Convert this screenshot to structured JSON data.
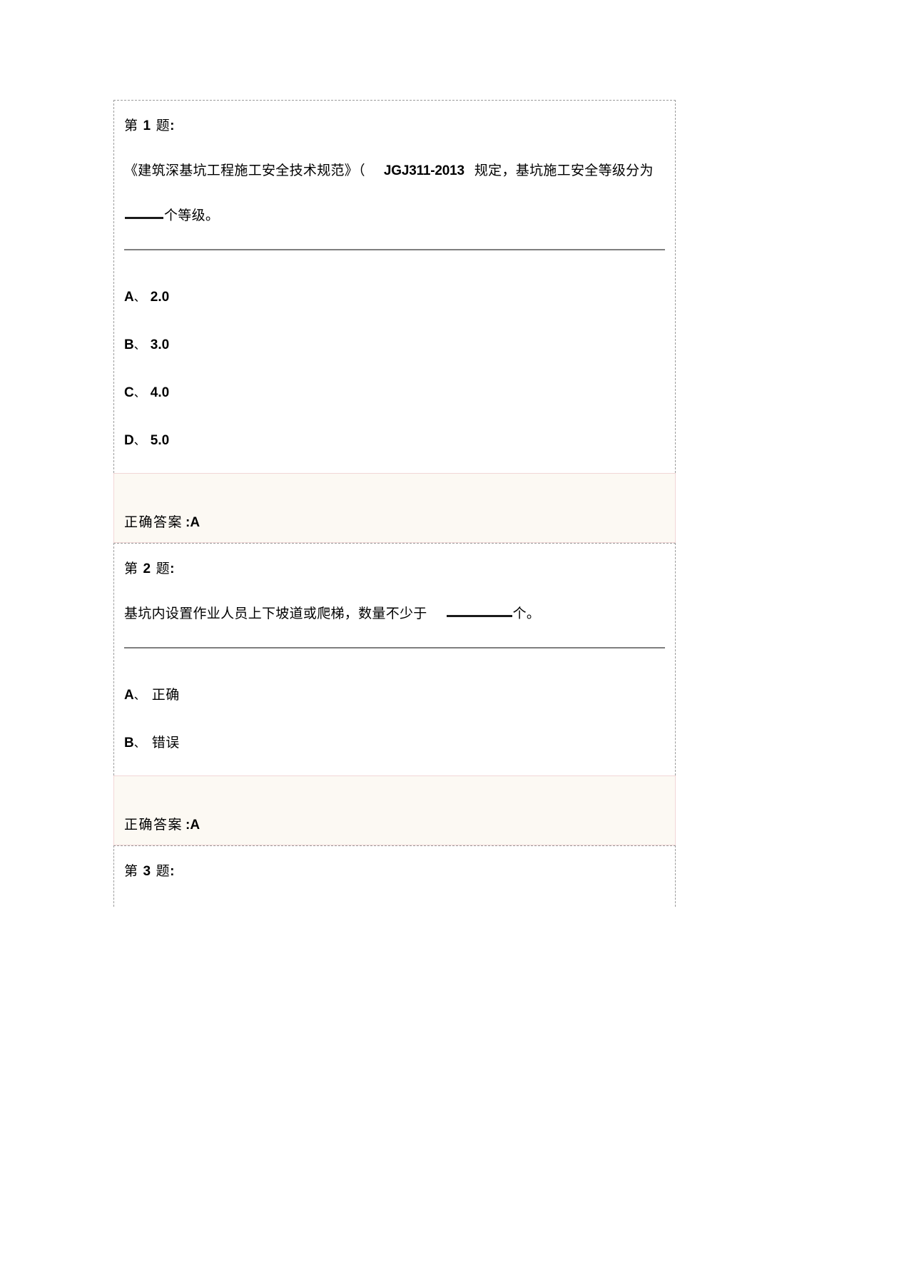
{
  "document": {
    "type": "exam-question-sheet",
    "background_color": "#ffffff",
    "card_border_color": "#9b9b9b",
    "answer_box_border_color": "#f2d7d7",
    "answer_box_background_color": "#fcf9f3",
    "divider_color": "#7f7f7f"
  },
  "questions": [
    {
      "header_prefix": "第",
      "number": "1",
      "header_suffix": "题",
      "header_colon": ":",
      "stem_part1": "《建筑深基坑工程施工安全技术规范》（",
      "stem_code": "JGJ311-2013",
      "stem_part2": "规定，基坑施工安全等级分为",
      "stem_part3": "个等级。",
      "options": [
        {
          "letter": "A",
          "separator": "、",
          "value": "2.0",
          "value_style": "numeric"
        },
        {
          "letter": "B",
          "separator": "、",
          "value": "3.0",
          "value_style": "numeric"
        },
        {
          "letter": "C",
          "separator": "、",
          "value": "4.0",
          "value_style": "numeric"
        },
        {
          "letter": "D",
          "separator": "、",
          "value": "5.0",
          "value_style": "numeric"
        }
      ],
      "answer_label": "正确答案",
      "answer_value": ":A"
    },
    {
      "header_prefix": "第",
      "number": "2",
      "header_suffix": "题",
      "header_colon": ":",
      "stem_part1": "基坑内设置作业人员上下坡道或爬梯，数量不少于",
      "stem_part3": "个。",
      "options": [
        {
          "letter": "A",
          "separator": "、",
          "value": "正确",
          "value_style": "chinese"
        },
        {
          "letter": "B",
          "separator": "、",
          "value": "错误",
          "value_style": "chinese"
        }
      ],
      "answer_label": "正确答案",
      "answer_value": ":A"
    },
    {
      "header_prefix": "第",
      "number": "3",
      "header_suffix": "题",
      "header_colon": ":"
    }
  ]
}
